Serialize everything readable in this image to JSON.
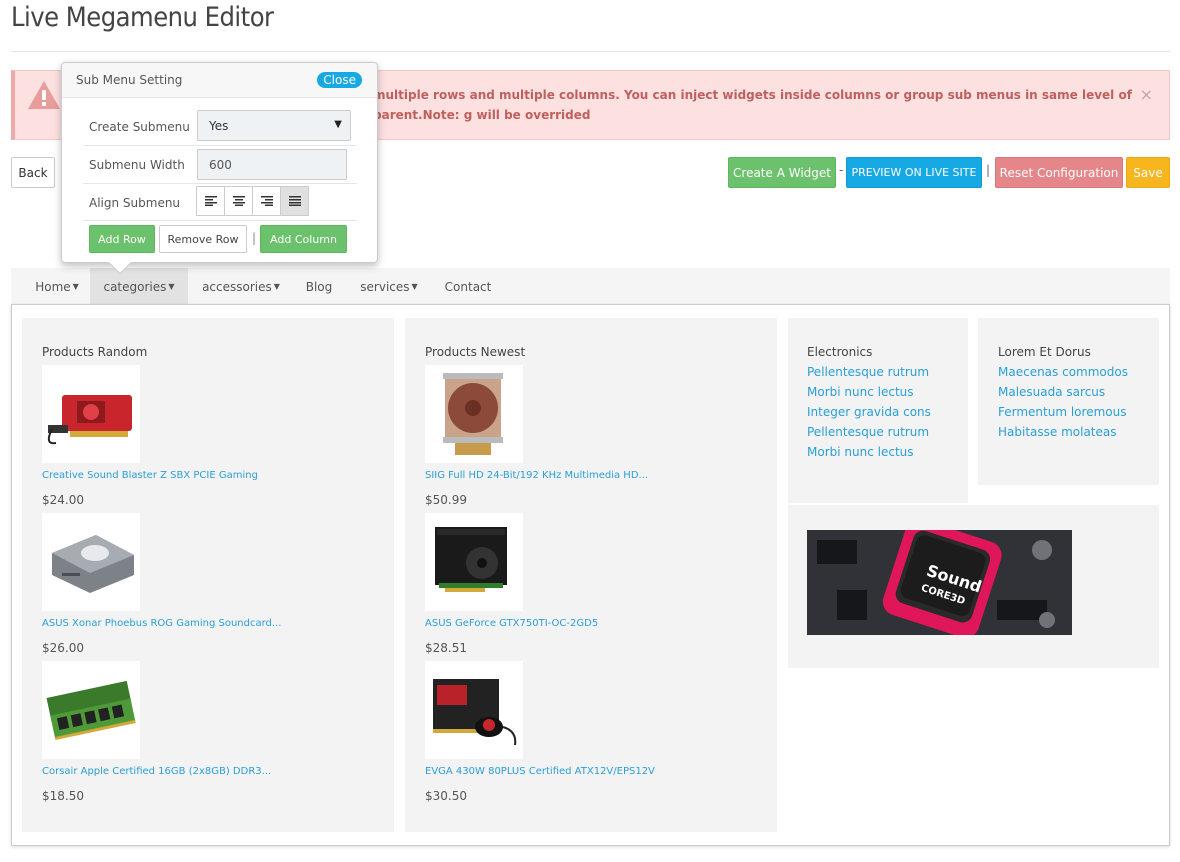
{
  "page": {
    "title": "Live Megamenu Editor"
  },
  "alert": {
    "text": "multiple rows and multiple columns. You can inject widgets inside columns or group sub menus in same level of parent.Note: g will be overrided",
    "close": "×"
  },
  "toolbar": {
    "back": "Back",
    "create_widget": "Create A Widget",
    "sep1": "-",
    "preview": "PREVIEW ON LIVE SITE",
    "sep2": "|",
    "reset": "Reset Configuration",
    "save": "Save"
  },
  "popup": {
    "title": "Sub Menu Setting",
    "close": "Close",
    "create_submenu_label": "Create Submenu",
    "create_submenu_value": "Yes",
    "submenu_width_label": "Submenu Width",
    "submenu_width_value": "600",
    "align_label": "Align Submenu",
    "align_active": "justify",
    "add_row": "Add Row",
    "remove_row": "Remove Row",
    "sep": "|",
    "add_column": "Add Column"
  },
  "menu": {
    "items": [
      {
        "label": "Home",
        "dropdown": true
      },
      {
        "label": "categories",
        "dropdown": true,
        "active": true
      },
      {
        "label": "accessories",
        "dropdown": true
      },
      {
        "label": "Blog",
        "dropdown": false
      },
      {
        "label": "services",
        "dropdown": true
      },
      {
        "label": "Contact",
        "dropdown": false
      }
    ]
  },
  "mega": {
    "random": {
      "heading": "Products Random",
      "products": [
        {
          "name": "Creative Sound Blaster Z SBX PCIE Gaming",
          "price": "$24.00"
        },
        {
          "name": "ASUS Xonar Phoebus ROG Gaming Soundcard...",
          "price": "$26.00"
        },
        {
          "name": "Corsair Apple Certified 16GB (2x8GB) DDR3...",
          "price": "$18.50"
        }
      ]
    },
    "newest": {
      "heading": "Products Newest",
      "products": [
        {
          "name": "SIIG Full HD 24-Bit/192 KHz Multimedia HD...",
          "price": "$50.99"
        },
        {
          "name": "ASUS GeForce GTX750TI-OC-2GD5",
          "price": "$28.51"
        },
        {
          "name": "EVGA 430W 80PLUS Certified ATX12V/EPS12V",
          "price": "$30.50"
        }
      ]
    },
    "electronics": {
      "heading": "Electronics",
      "links": [
        "Pellentesque rutrum",
        "Morbi nunc lectus",
        "Integer gravida cons",
        "Pellentesque rutrum",
        "Morbi nunc lectus"
      ]
    },
    "lorem": {
      "heading": "Lorem Et Dorus",
      "links": [
        "Maecenas commodos",
        "Malesuada sarcus",
        "Fermentum loremous",
        "Habitasse molateas"
      ]
    },
    "banner": {
      "text_line1": "Sound",
      "text_line2": "CORE3D"
    }
  },
  "colors": {
    "accent_blue": "#17a9e3",
    "green": "#6cc26c",
    "red": "#e4868a",
    "orange": "#f7b51e",
    "link": "#2a9fd6"
  }
}
